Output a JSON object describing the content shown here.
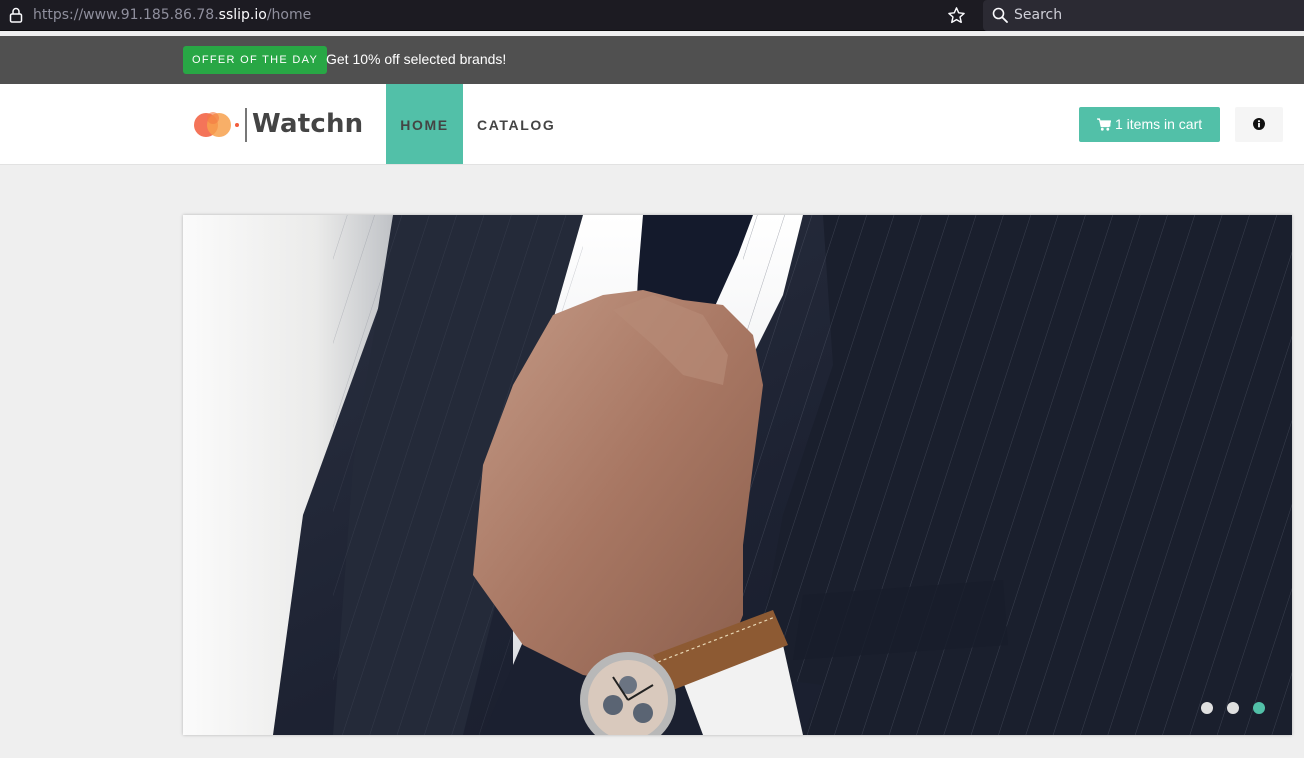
{
  "browser": {
    "url_prefix": "https://www.91.185.86.78.",
    "url_domain": "sslip.io",
    "url_path": "/home",
    "search_placeholder": "Search"
  },
  "promo": {
    "badge": "OFFER OF THE DAY",
    "text": "Get 10% off selected brands!",
    "badge_color": "#28a745"
  },
  "navbar": {
    "logo_text": "Watchn",
    "items": [
      {
        "label": "HOME",
        "active": true
      },
      {
        "label": "CATALOG",
        "active": false
      }
    ],
    "cart_label": "1 items in cart",
    "accent_color": "#52c0a8"
  },
  "carousel": {
    "slide_count": 3,
    "active_slide": 3,
    "image": "man-in-pinstripe-suit-with-wristwatch"
  }
}
